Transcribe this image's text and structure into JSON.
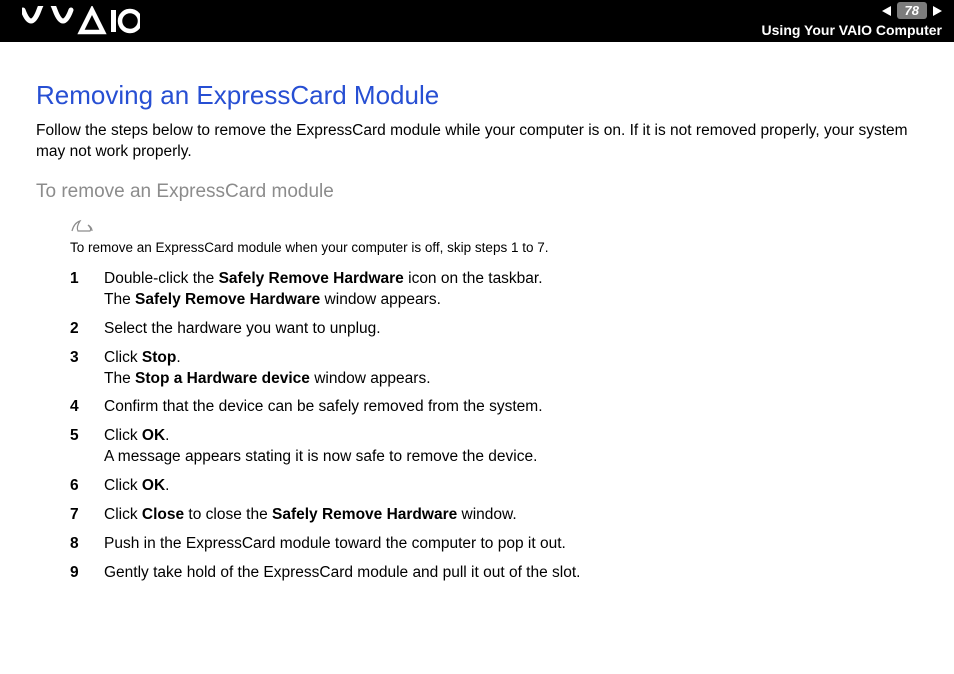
{
  "header": {
    "page_number": "78",
    "section_title": "Using Your VAIO Computer"
  },
  "title": "Removing an ExpressCard Module",
  "intro": "Follow the steps below to remove the ExpressCard module while your computer is on. If it is not removed properly, your system may not work properly.",
  "subtitle": "To remove an ExpressCard module",
  "note": "To remove an ExpressCard module when your computer is off, skip steps 1 to 7.",
  "steps": {
    "s1a": "Double-click the ",
    "s1b": "Safely Remove Hardware",
    "s1c": " icon on the taskbar.",
    "s1d": "The ",
    "s1e": "Safely Remove Hardware",
    "s1f": " window appears.",
    "s2": "Select the hardware you want to unplug.",
    "s3a": "Click ",
    "s3b": "Stop",
    "s3c": ".",
    "s3d": "The ",
    "s3e": "Stop a Hardware device",
    "s3f": " window appears.",
    "s4": "Confirm that the device can be safely removed from the system.",
    "s5a": "Click ",
    "s5b": "OK",
    "s5c": ".",
    "s5d": "A message appears stating it is now safe to remove the device.",
    "s6a": "Click ",
    "s6b": "OK",
    "s6c": ".",
    "s7a": "Click ",
    "s7b": "Close",
    "s7c": " to close the ",
    "s7d": "Safely Remove Hardware",
    "s7e": " window.",
    "s8": "Push in the ExpressCard module toward the computer to pop it out.",
    "s9": "Gently take hold of the ExpressCard module and pull it out of the slot."
  }
}
